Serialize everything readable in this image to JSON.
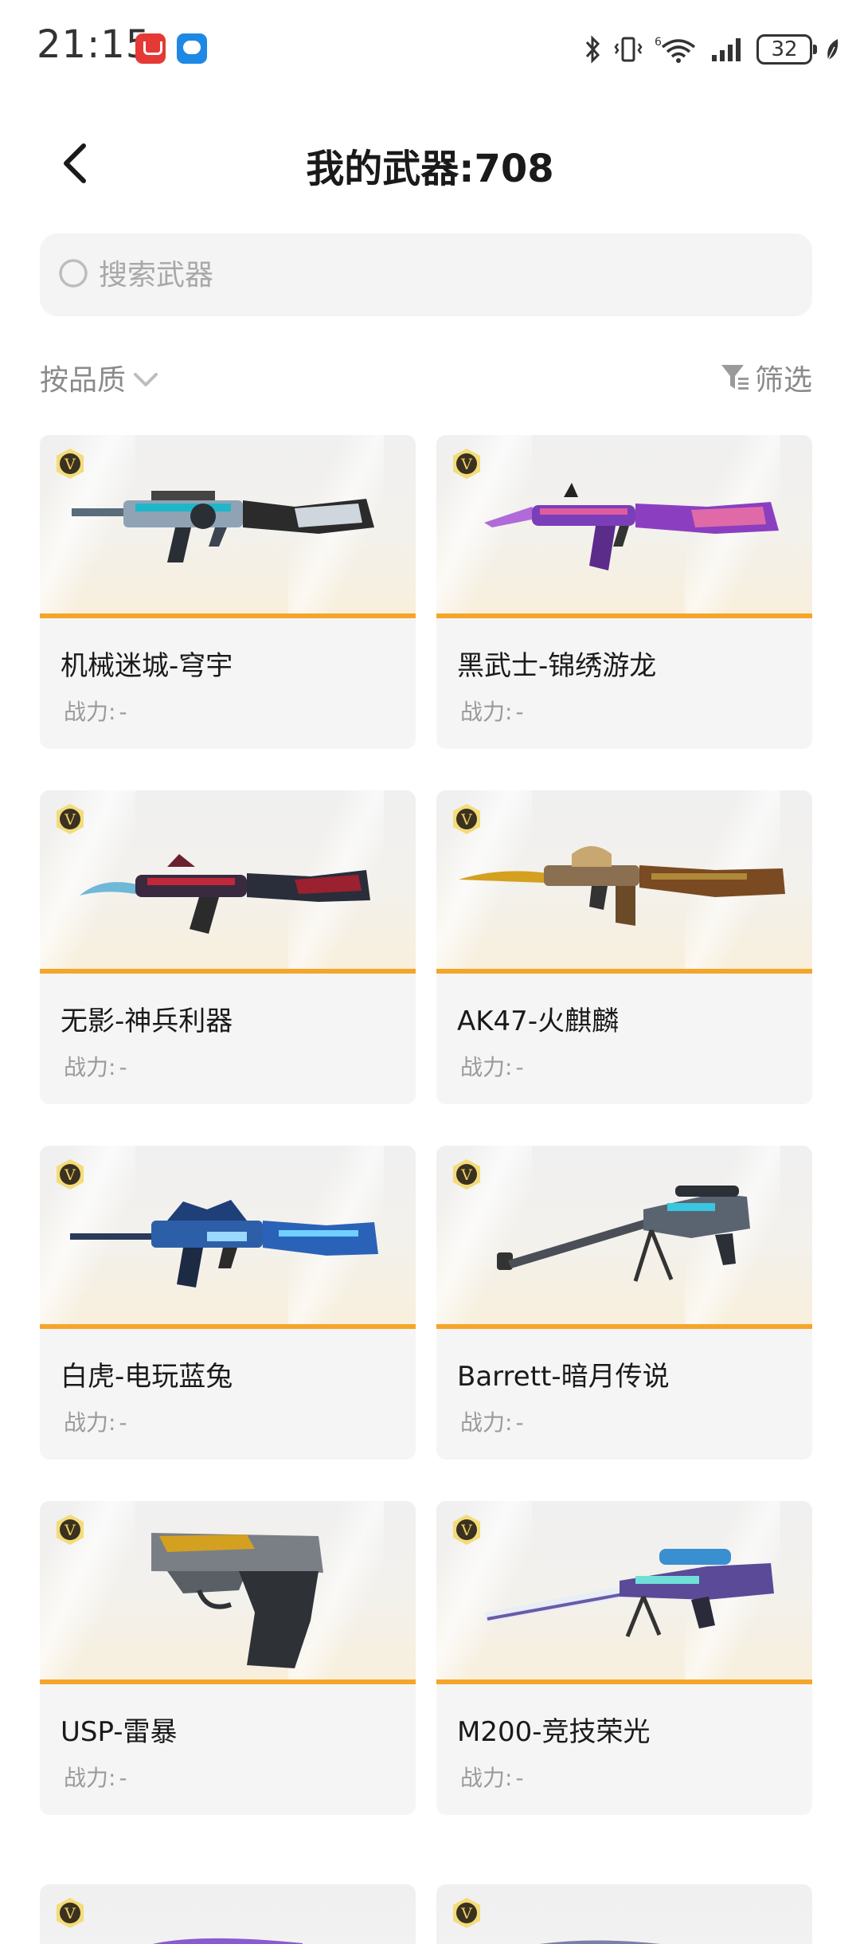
{
  "status_bar": {
    "time": "21:15",
    "network": "6",
    "battery": "32",
    "icons": [
      "app-store-icon",
      "message-icon",
      "bluetooth-icon",
      "vibrate-icon",
      "wifi-icon",
      "signal-icon",
      "battery-icon",
      "leaf-icon"
    ]
  },
  "header": {
    "title": "我的武器:708",
    "back_icon": "chevron-left-icon"
  },
  "search": {
    "placeholder": "搜索武器",
    "value": ""
  },
  "toolbar": {
    "sort_label": "按品质",
    "filter_label": "筛选"
  },
  "badge_letter": "V",
  "weapons": [
    {
      "name": "机械迷城-穹宇",
      "power_label": "战力:",
      "power_value": "-"
    },
    {
      "name": "黑武士-锦绣游龙",
      "power_label": "战力:",
      "power_value": "-"
    },
    {
      "name": "无影-神兵利器",
      "power_label": "战力:",
      "power_value": "-"
    },
    {
      "name": "AK47-火麒麟",
      "power_label": "战力:",
      "power_value": "-"
    },
    {
      "name": "白虎-电玩蓝兔",
      "power_label": "战力:",
      "power_value": "-"
    },
    {
      "name": "Barrett-暗月传说",
      "power_label": "战力:",
      "power_value": "-"
    },
    {
      "name": "USP-雷暴",
      "power_label": "战力:",
      "power_value": "-"
    },
    {
      "name": "M200-竞技荣光",
      "power_label": "战力:",
      "power_value": "-"
    }
  ],
  "colors": {
    "accent_orange": "#f5a52a",
    "badge_gold": "#c9a227",
    "card_bg": "#f5f5f5",
    "muted_text": "#9a9a9a"
  }
}
